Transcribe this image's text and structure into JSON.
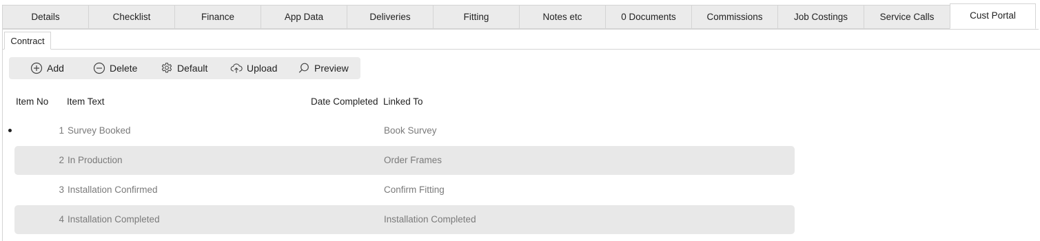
{
  "tabs": [
    {
      "label": "Details",
      "active": false
    },
    {
      "label": "Checklist",
      "active": false
    },
    {
      "label": "Finance",
      "active": false
    },
    {
      "label": "App Data",
      "active": false
    },
    {
      "label": "Deliveries",
      "active": false
    },
    {
      "label": "Fitting",
      "active": false
    },
    {
      "label": "Notes etc",
      "active": false
    },
    {
      "label": "0 Documents",
      "active": false
    },
    {
      "label": "Commissions",
      "active": false
    },
    {
      "label": "Job Costings",
      "active": false
    },
    {
      "label": "Service Calls",
      "active": false
    },
    {
      "label": "Cust Portal",
      "active": true
    }
  ],
  "subtab": {
    "label": "Contract"
  },
  "toolbar": {
    "add": "Add",
    "delete": "Delete",
    "default": "Default",
    "upload": "Upload",
    "preview": "Preview"
  },
  "grid": {
    "columns": {
      "item_no": "Item No",
      "item_text": "Item Text",
      "date_completed": "Date Completed",
      "linked_to": "Linked To"
    },
    "rows": [
      {
        "item_no": "1",
        "item_text": "Survey Booked",
        "date_completed": "",
        "linked_to": "Book Survey"
      },
      {
        "item_no": "2",
        "item_text": "In Production",
        "date_completed": "",
        "linked_to": "Order Frames"
      },
      {
        "item_no": "3",
        "item_text": "Installation Confirmed",
        "date_completed": "",
        "linked_to": "Confirm Fitting"
      },
      {
        "item_no": "4",
        "item_text": "Installation Completed",
        "date_completed": "",
        "linked_to": "Installation Completed"
      }
    ]
  },
  "colors": {
    "tab_bg": "#ebebeb",
    "row_alt_bg": "#e8e8e8",
    "cell_text": "#7a7a7a",
    "border": "#d4d4d4"
  }
}
